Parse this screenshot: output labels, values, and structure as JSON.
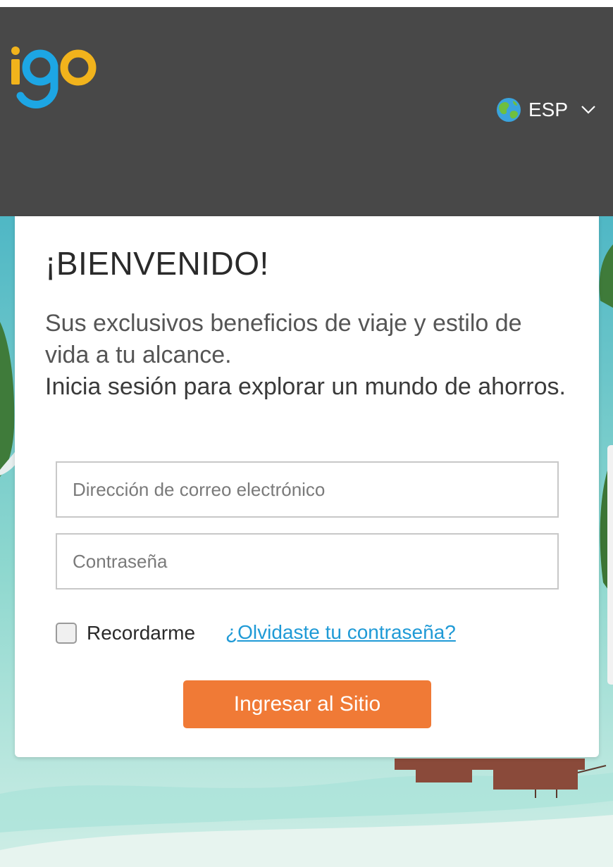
{
  "header": {
    "logo_text": "igo",
    "language": {
      "label": "ESP",
      "icon": "globe-icon",
      "dropdown_icon": "chevron-down-icon"
    }
  },
  "login": {
    "title": "¡BIENVENIDO!",
    "subtitle": "Sus exclusivos beneficios de viaje y estilo de vida a tu alcance.",
    "subtitle2": "Inicia sesión para explorar un mundo de ahorros.",
    "email_placeholder": "Dirección de correo electrónico",
    "email_value": "",
    "password_placeholder": "Contraseña",
    "password_value": "",
    "remember_label": "Recordarme",
    "remember_checked": false,
    "forgot_link": "¿Olvidaste tu contraseña?",
    "submit_label": "Ingresar al Sitio"
  },
  "colors": {
    "header_bg": "#484848",
    "logo_blue": "#1da6e4",
    "logo_yellow": "#f1b31c",
    "accent_orange": "#f07a36",
    "link_blue": "#1f9ad6",
    "water_turquoise": "#8fd8cf"
  }
}
